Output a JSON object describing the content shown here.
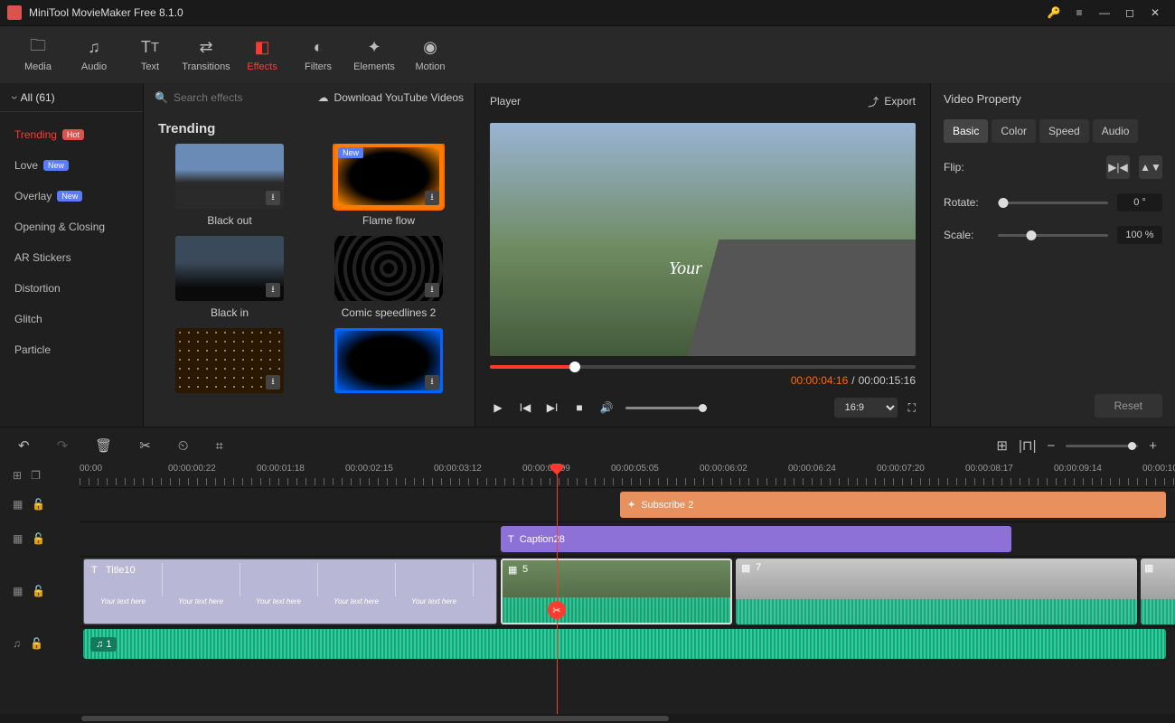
{
  "app": {
    "title": "MiniTool MovieMaker Free 8.1.0"
  },
  "toolbar": [
    {
      "id": "media",
      "label": "Media"
    },
    {
      "id": "audio",
      "label": "Audio"
    },
    {
      "id": "text",
      "label": "Text"
    },
    {
      "id": "transitions",
      "label": "Transitions"
    },
    {
      "id": "effects",
      "label": "Effects",
      "active": true
    },
    {
      "id": "filters",
      "label": "Filters"
    },
    {
      "id": "elements",
      "label": "Elements"
    },
    {
      "id": "motion",
      "label": "Motion"
    }
  ],
  "categories": {
    "all_label": "All (61)",
    "items": [
      {
        "label": "Trending",
        "badge": "Hot",
        "active": true
      },
      {
        "label": "Love",
        "badge": "New"
      },
      {
        "label": "Overlay",
        "badge": "New"
      },
      {
        "label": "Opening & Closing"
      },
      {
        "label": "AR Stickers"
      },
      {
        "label": "Distortion"
      },
      {
        "label": "Glitch"
      },
      {
        "label": "Particle"
      }
    ]
  },
  "browser": {
    "search_placeholder": "Search effects",
    "yt_label": "Download YouTube Videos",
    "section": "Trending",
    "cards": [
      {
        "label": "Black out"
      },
      {
        "label": "Flame flow",
        "new": true,
        "selected": true
      },
      {
        "label": "Black in"
      },
      {
        "label": "Comic speedlines 2"
      },
      {
        "label": ""
      },
      {
        "label": ""
      }
    ]
  },
  "player": {
    "title": "Player",
    "export_label": "Export",
    "overlay_text": "Your",
    "current_time": "00:00:04:16",
    "total_time": "00:00:15:16",
    "aspect": "16:9"
  },
  "property": {
    "title": "Video Property",
    "tabs": [
      "Basic",
      "Color",
      "Speed",
      "Audio"
    ],
    "active_tab": 0,
    "flip_label": "Flip:",
    "rotate_label": "Rotate:",
    "rotate_value": "0 °",
    "scale_label": "Scale:",
    "scale_value": "100 %",
    "reset_label": "Reset"
  },
  "timeline": {
    "ruler": [
      "00:00",
      "00:00:00:22",
      "00:00:01:18",
      "00:00:02:15",
      "00:00:03:12",
      "00:00:04:09",
      "00:00:05:05",
      "00:00:06:02",
      "00:00:06:24",
      "00:00:07:20",
      "00:00:08:17",
      "00:00:09:14",
      "00:00:10"
    ],
    "clips": {
      "element": "Subscribe 2",
      "caption": "Caption28",
      "title": "Title10",
      "placeholder": "Your text here",
      "vid_a": "5",
      "vid_b": "7",
      "audio": "1"
    }
  }
}
